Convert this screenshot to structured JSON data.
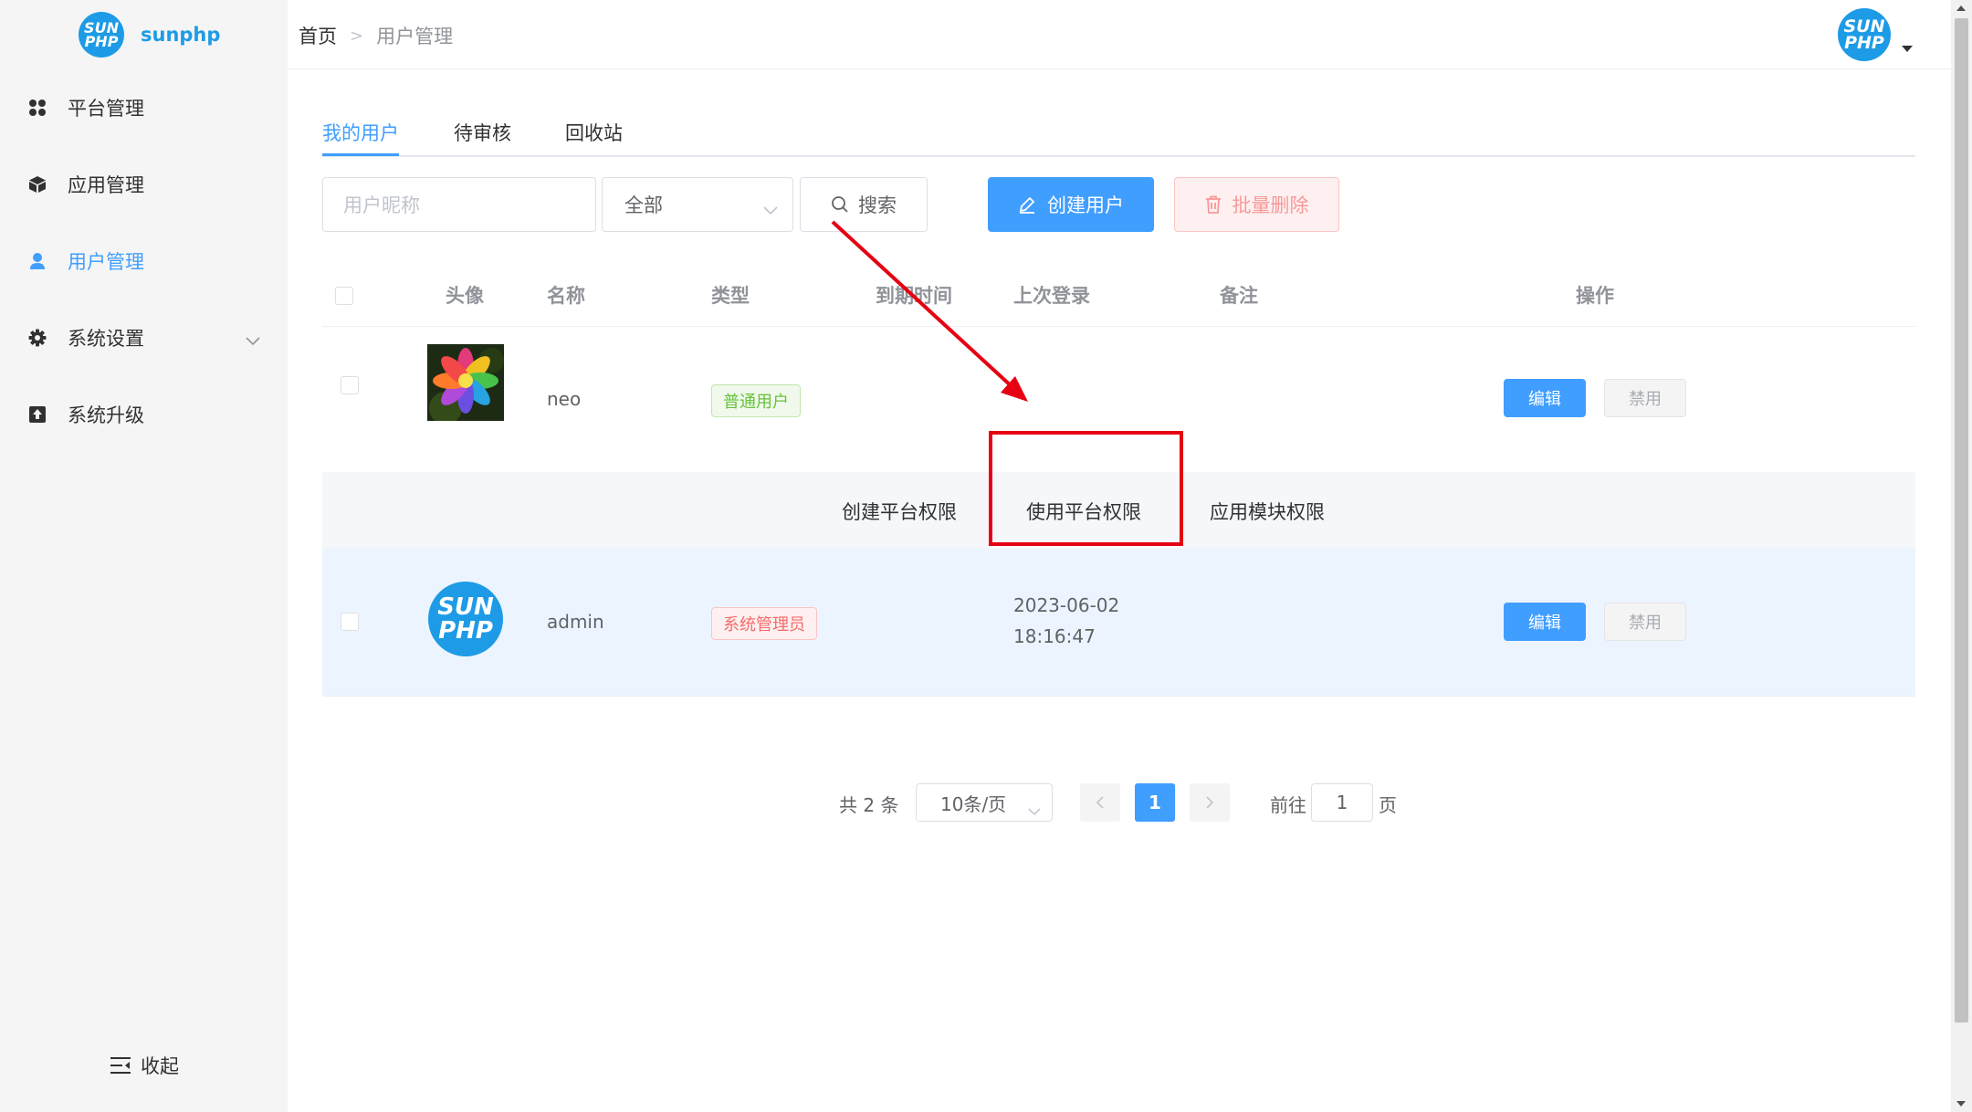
{
  "app": {
    "name": "sunphp",
    "logo_top": "SUN",
    "logo_bottom": "PHP"
  },
  "sidebar": {
    "items": [
      {
        "label": "平台管理",
        "icon": "apps-grid-icon"
      },
      {
        "label": "应用管理",
        "icon": "cube-icon"
      },
      {
        "label": "用户管理",
        "icon": "user-icon",
        "active": true
      },
      {
        "label": "系统设置",
        "icon": "gear-icon",
        "has_children": true
      },
      {
        "label": "系统升级",
        "icon": "upload-icon"
      }
    ],
    "collapse_label": "收起"
  },
  "header": {
    "breadcrumb": {
      "home": "首页",
      "current": "用户管理"
    }
  },
  "tabs": [
    {
      "label": "我的用户",
      "active": true
    },
    {
      "label": "待审核"
    },
    {
      "label": "回收站"
    }
  ],
  "filters": {
    "search_placeholder": "用户昵称",
    "type_select_value": "全部",
    "search_button": "搜索",
    "create_button": "创建用户",
    "bulk_delete_button": "批量删除"
  },
  "table": {
    "columns": [
      "头像",
      "名称",
      "类型",
      "到期时间",
      "上次登录",
      "备注",
      "操作"
    ],
    "rows": [
      {
        "name": "neo",
        "type": "普通用户",
        "expire": "",
        "last_login_date": "",
        "last_login_time": "",
        "remark": "",
        "edit": "编辑",
        "disable": "禁用"
      },
      {
        "name": "admin",
        "type": "系统管理员",
        "expire": "",
        "last_login_date": "2023-06-02",
        "last_login_time": "18:16:47",
        "remark": "",
        "edit": "编辑",
        "disable": "禁用"
      }
    ],
    "permission_links": [
      "创建平台权限",
      "使用平台权限",
      "应用模块权限"
    ]
  },
  "pagination": {
    "total": "共 2 条",
    "page_size": "10条/页",
    "current_page": "1",
    "goto_label": "前往",
    "goto_value": "1",
    "page_suffix": "页"
  },
  "colors": {
    "primary": "#409eff",
    "annotation": "#e60012"
  }
}
